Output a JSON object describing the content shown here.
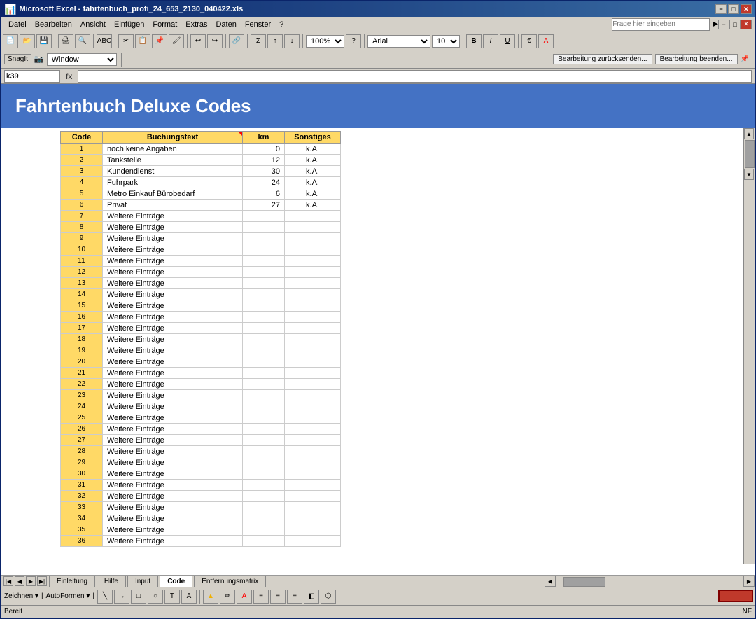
{
  "window": {
    "title": "Microsoft Excel - fahrtenbuch_profi_24_653_2130_040422.xls",
    "title_icon": "excel-icon",
    "min_btn": "−",
    "max_btn": "□",
    "close_btn": "✕"
  },
  "toolbar1": {
    "zoom": "100%",
    "font_name": "Arial",
    "font_size": "10"
  },
  "snagit": {
    "label": "SnagIt",
    "window_combo": "Window"
  },
  "menu": {
    "items": [
      "Datei",
      "Bearbeiten",
      "Ansicht",
      "Einfügen",
      "Format",
      "Extras",
      "Daten",
      "Fenster",
      "?"
    ]
  },
  "formula_bar": {
    "name_box": "k39",
    "fx": "fx"
  },
  "right_menu": {
    "label": "Frage hier eingeben"
  },
  "sheet": {
    "heading": "Fahrtenbuch Deluxe Codes"
  },
  "table": {
    "headers": [
      "Code",
      "Buchungstext",
      "km",
      "Sonstiges"
    ],
    "rows": [
      {
        "code": "1",
        "buchungstext": "noch keine Angaben",
        "km": "0",
        "sonstiges": "k.A."
      },
      {
        "code": "2",
        "buchungstext": "Tankstelle",
        "km": "12",
        "sonstiges": "k.A."
      },
      {
        "code": "3",
        "buchungstext": "Kundendienst",
        "km": "30",
        "sonstiges": "k.A."
      },
      {
        "code": "4",
        "buchungstext": "Fuhrpark",
        "km": "24",
        "sonstiges": "k.A."
      },
      {
        "code": "5",
        "buchungstext": "Metro Einkauf Bürobedarf",
        "km": "6",
        "sonstiges": "k.A."
      },
      {
        "code": "6",
        "buchungstext": "Privat",
        "km": "27",
        "sonstiges": "k.A."
      },
      {
        "code": "7",
        "buchungstext": "Weitere Einträge",
        "km": "",
        "sonstiges": ""
      },
      {
        "code": "8",
        "buchungstext": "Weitere Einträge",
        "km": "",
        "sonstiges": ""
      },
      {
        "code": "9",
        "buchungstext": "Weitere Einträge",
        "km": "",
        "sonstiges": ""
      },
      {
        "code": "10",
        "buchungstext": "Weitere Einträge",
        "km": "",
        "sonstiges": ""
      },
      {
        "code": "11",
        "buchungstext": "Weitere Einträge",
        "km": "",
        "sonstiges": ""
      },
      {
        "code": "12",
        "buchungstext": "Weitere Einträge",
        "km": "",
        "sonstiges": ""
      },
      {
        "code": "13",
        "buchungstext": "Weitere Einträge",
        "km": "",
        "sonstiges": ""
      },
      {
        "code": "14",
        "buchungstext": "Weitere Einträge",
        "km": "",
        "sonstiges": ""
      },
      {
        "code": "15",
        "buchungstext": "Weitere Einträge",
        "km": "",
        "sonstiges": ""
      },
      {
        "code": "16",
        "buchungstext": "Weitere Einträge",
        "km": "",
        "sonstiges": ""
      },
      {
        "code": "17",
        "buchungstext": "Weitere Einträge",
        "km": "",
        "sonstiges": ""
      },
      {
        "code": "18",
        "buchungstext": "Weitere Einträge",
        "km": "",
        "sonstiges": ""
      },
      {
        "code": "19",
        "buchungstext": "Weitere Einträge",
        "km": "",
        "sonstiges": ""
      },
      {
        "code": "20",
        "buchungstext": "Weitere Einträge",
        "km": "",
        "sonstiges": ""
      },
      {
        "code": "21",
        "buchungstext": "Weitere Einträge",
        "km": "",
        "sonstiges": ""
      },
      {
        "code": "22",
        "buchungstext": "Weitere Einträge",
        "km": "",
        "sonstiges": ""
      },
      {
        "code": "23",
        "buchungstext": "Weitere Einträge",
        "km": "",
        "sonstiges": ""
      },
      {
        "code": "24",
        "buchungstext": "Weitere Einträge",
        "km": "",
        "sonstiges": ""
      },
      {
        "code": "25",
        "buchungstext": "Weitere Einträge",
        "km": "",
        "sonstiges": ""
      },
      {
        "code": "26",
        "buchungstext": "Weitere Einträge",
        "km": "",
        "sonstiges": ""
      },
      {
        "code": "27",
        "buchungstext": "Weitere Einträge",
        "km": "",
        "sonstiges": ""
      },
      {
        "code": "28",
        "buchungstext": "Weitere Einträge",
        "km": "",
        "sonstiges": ""
      },
      {
        "code": "29",
        "buchungstext": "Weitere Einträge",
        "km": "",
        "sonstiges": ""
      },
      {
        "code": "30",
        "buchungstext": "Weitere Einträge",
        "km": "",
        "sonstiges": ""
      },
      {
        "code": "31",
        "buchungstext": "Weitere Einträge",
        "km": "",
        "sonstiges": ""
      },
      {
        "code": "32",
        "buchungstext": "Weitere Einträge",
        "km": "",
        "sonstiges": ""
      },
      {
        "code": "33",
        "buchungstext": "Weitere Einträge",
        "km": "",
        "sonstiges": ""
      },
      {
        "code": "34",
        "buchungstext": "Weitere Einträge",
        "km": "",
        "sonstiges": ""
      },
      {
        "code": "35",
        "buchungstext": "Weitere Einträge",
        "km": "",
        "sonstiges": ""
      },
      {
        "code": "36",
        "buchungstext": "Weitere Einträge",
        "km": "",
        "sonstiges": ""
      }
    ]
  },
  "sheet_tabs": {
    "tabs": [
      "Einleitung",
      "Hilfe",
      "Input",
      "Code",
      "Entfernungsmatrix"
    ],
    "active": "Code"
  },
  "status_bar": {
    "left": "Bereit",
    "right": "NF"
  },
  "drawing_toolbar": {
    "zeichnen_label": "Zeichnen ▾",
    "autoformen_label": "AutoFormen ▾"
  },
  "notification_bar": {
    "back_label": "Bearbeitung zurücksenden...",
    "end_label": "Bearbeitung beenden..."
  }
}
